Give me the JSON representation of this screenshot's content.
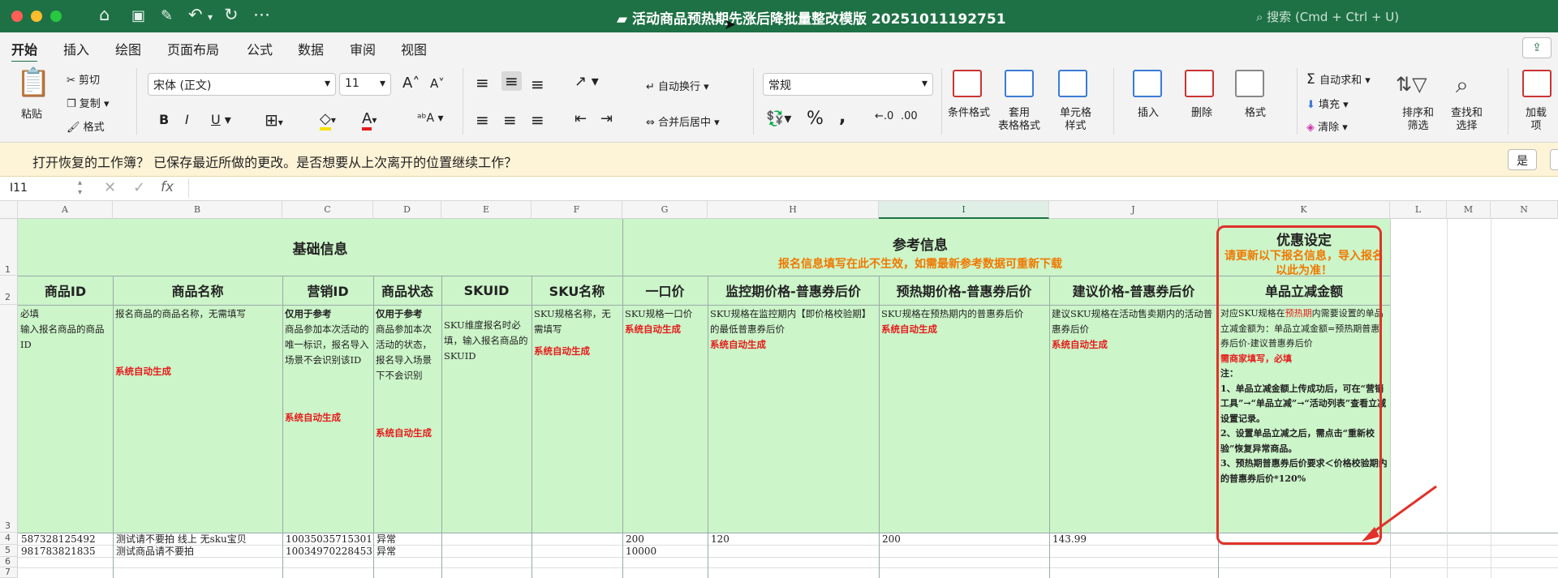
{
  "window": {
    "title": "活动商品预热期先涨后降批量整改模版 20251011192751",
    "search_placeholder": "搜索 (Cmd + Ctrl + U)"
  },
  "tabs": [
    "开始",
    "插入",
    "绘图",
    "页面布局",
    "公式",
    "数据",
    "审阅",
    "视图"
  ],
  "ribbon": {
    "paste": "粘贴",
    "cut": "剪切",
    "copy": "复制",
    "format_painter": "格式",
    "font": "宋体 (正文)",
    "font_size": "11",
    "bold": "B",
    "italic": "I",
    "underline": "U",
    "wrap_text": "自动换行",
    "merge_center": "合并后居中",
    "number_format": "常规",
    "cond_format": "条件格式",
    "table_format_1": "套用",
    "table_format_2": "表格格式",
    "cell_style_1": "单元格",
    "cell_style_2": "样式",
    "insert": "插入",
    "delete": "删除",
    "format": "格式",
    "autosum": "自动求和",
    "fill": "填充",
    "clear": "清除",
    "sort_1": "排序和",
    "sort_2": "筛选",
    "find_1": "查找和",
    "find_2": "选择",
    "addin_1": "加载",
    "addin_2": "项"
  },
  "infobar": {
    "text": "打开恢复的工作簿？ 已保存最近所做的更改。是否想要从上次离开的位置继续工作？",
    "yes": "是"
  },
  "formula_bar": {
    "name_box": "I11",
    "fx": "fx"
  },
  "columns": [
    "A",
    "B",
    "C",
    "D",
    "E",
    "F",
    "G",
    "H",
    "I",
    "J",
    "K",
    "L",
    "M",
    "N"
  ],
  "rows": [
    "1",
    "2",
    "3",
    "4",
    "5",
    "6",
    "7"
  ],
  "sheet": {
    "group1": "基础信息",
    "group2_title": "参考信息",
    "group2_note": "报名信息填写在此不生效，如需最新参考数据可重新下载",
    "group3_title": "优惠设定",
    "group3_note": "请更新以下报名信息，导入报名以此为准！",
    "headers": [
      "商品ID",
      "商品名称",
      "营销ID",
      "商品状态",
      "SKUID",
      "SKU名称",
      "一口价",
      "监控期价格-普惠券后价",
      "预热期价格-普惠券后价",
      "建议价格-普惠券后价",
      "单品立减金额"
    ],
    "desc": {
      "a1": "必填",
      "a2": "输入报名商品的商品ID",
      "b1": "报名商品的商品名称，无需填写",
      "b2": "系统自动生成",
      "c1": "仅用于参考",
      "c2": "商品参加本次活动的唯一标识，报名导入场景不会识别该ID",
      "c3": "系统自动生成",
      "d1": "仅用于参考",
      "d2": "商品参加本次活动的状态，报名导入场景下不会识别",
      "d3": "系统自动生成",
      "e1": "SKU维度报名时必填，输入报名商品的SKUID",
      "f1": "SKU规格名称，无需填写",
      "f2": "系统自动生成",
      "g1": "SKU规格一口价",
      "g2": "系统自动生成",
      "h1": "SKU规格在监控期内【即价格校验期】的最低普惠券后价",
      "h2": "系统自动生成",
      "i1": "SKU规格在预热期内的普惠券后价",
      "i2": "系统自动生成",
      "j1": "建议SKU规格在活动售卖期内的活动普惠券后价",
      "j2": "系统自动生成",
      "k1": "对应SKU规格在",
      "k1r": "预热期",
      "k1b": "内需要设置的单品立减金额为：单品立减金额=预热期普惠券后价-建议普惠券后价",
      "k2": "需商家填写，必填",
      "k3": "注：",
      "k4": "1、单品立减金额上传成功后，可在“营销工具”→“单品立减”→“活动列表”查看立减设置记录。",
      "k5": "2、设置单品立减之后，需点击“重新校验”恢复异常商品。",
      "k6": "3、预热期普惠券后价要求＜价格校验期内的普惠券后价*120%"
    },
    "data_rows": [
      {
        "a": "587328125492",
        "b": "测试请不要拍 线上 无sku宝贝",
        "c": "10035035715301",
        "d": "异常",
        "g": "200",
        "h": "120",
        "i": "200",
        "j": "143.99"
      },
      {
        "a": "981783821835",
        "b": "测试商品请不要拍",
        "c": "10034970228453",
        "d": "异常",
        "g": "10000",
        "h": "",
        "i": "",
        "j": ""
      }
    ]
  }
}
